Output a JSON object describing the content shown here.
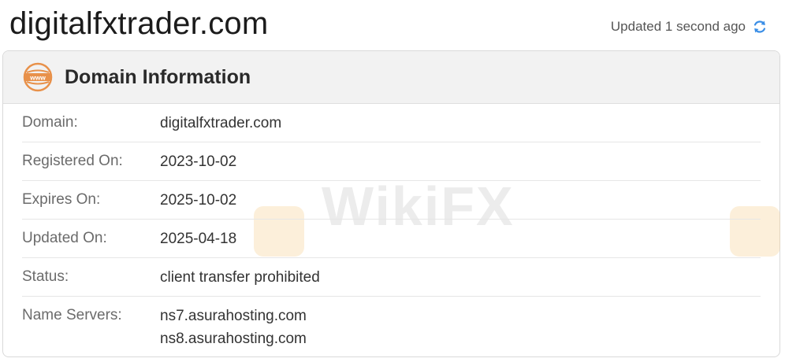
{
  "header": {
    "title": "digitalfxtrader.com",
    "updated_text": "Updated 1 second ago"
  },
  "card": {
    "title": "Domain Information",
    "rows": [
      {
        "label": "Domain:",
        "values": [
          "digitalfxtrader.com"
        ]
      },
      {
        "label": "Registered On:",
        "values": [
          "2023-10-02"
        ]
      },
      {
        "label": "Expires On:",
        "values": [
          "2025-10-02"
        ]
      },
      {
        "label": "Updated On:",
        "values": [
          "2025-04-18"
        ]
      },
      {
        "label": "Status:",
        "values": [
          "client transfer prohibited"
        ]
      },
      {
        "label": "Name Servers:",
        "values": [
          "ns7.asurahosting.com",
          "ns8.asurahosting.com"
        ]
      }
    ]
  },
  "watermark": {
    "text": "WikiFX"
  },
  "icons": {
    "header_icon": "www-icon",
    "refresh": "refresh-icon"
  },
  "colors": {
    "accent_orange": "#e8914a",
    "refresh_blue": "#3a8ee6"
  }
}
